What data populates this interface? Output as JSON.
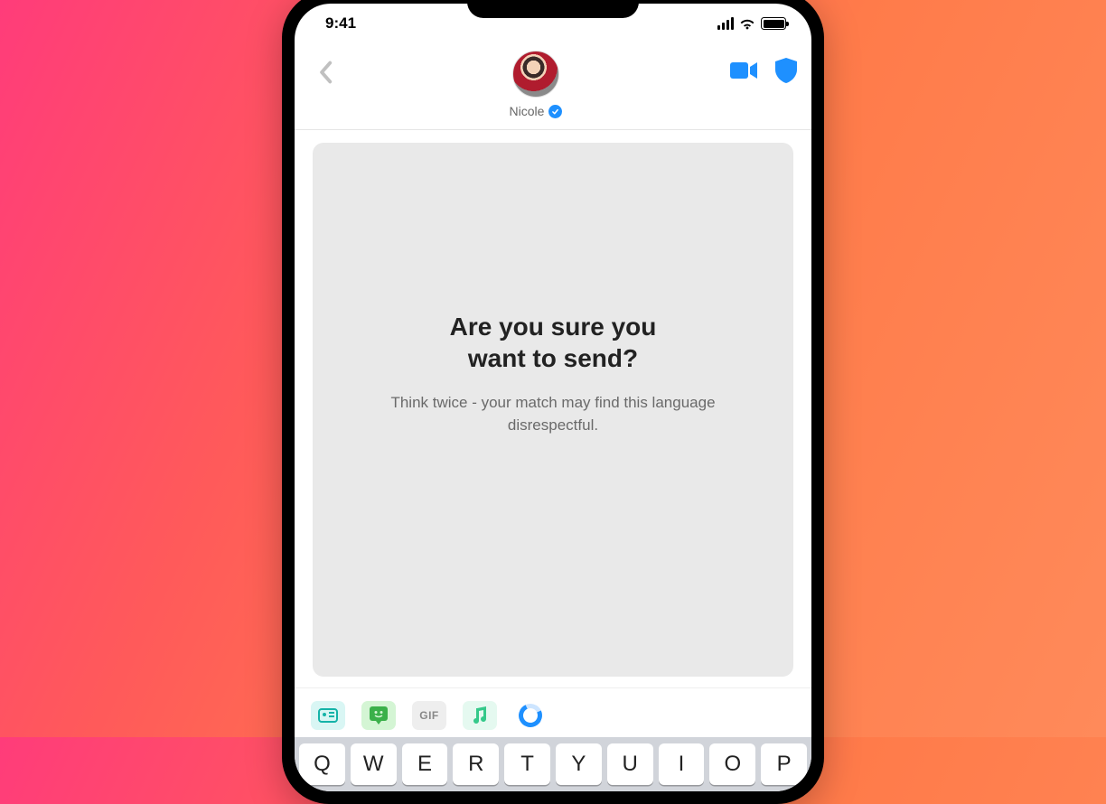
{
  "statusBar": {
    "time": "9:41"
  },
  "header": {
    "username": "Nicole"
  },
  "warning": {
    "title_line1": "Are you sure you",
    "title_line2": "want to send?",
    "subtitle": "Think twice - your match may find this language disrespectful."
  },
  "compose": {
    "gif_label": "GIF"
  },
  "keyboard": {
    "row1": [
      "Q",
      "W",
      "E",
      "R",
      "T",
      "Y",
      "U",
      "I",
      "O",
      "P"
    ]
  },
  "colors": {
    "accent": "#1e90ff"
  }
}
